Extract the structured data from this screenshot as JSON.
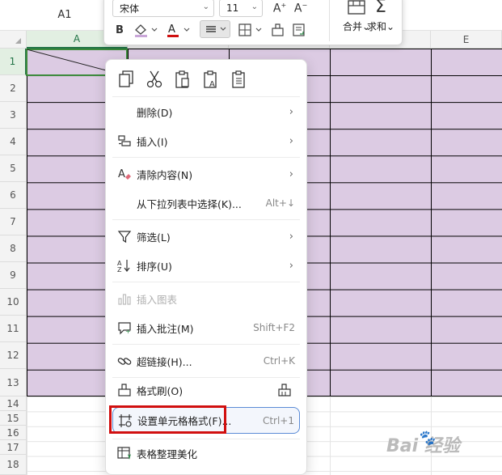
{
  "name_box": "A1",
  "columns": [
    {
      "label": "A",
      "active": true
    },
    {
      "label": "",
      "active": false
    },
    {
      "label": "",
      "active": false
    },
    {
      "label": "",
      "active": false
    },
    {
      "label": "E",
      "active": false
    }
  ],
  "rows": [
    "1",
    "2",
    "3",
    "4",
    "5",
    "6",
    "7",
    "8",
    "9",
    "10",
    "11",
    "12",
    "13",
    "14",
    "15",
    "16",
    "17",
    "18"
  ],
  "toolbar": {
    "font_name": "宋体",
    "font_size": "11",
    "merge_label": "合并",
    "sum_label": "求和"
  },
  "menu": {
    "clipboard_icons": [
      "copy-icon",
      "cut-icon",
      "paste-icon",
      "paste-values-icon",
      "paste-special-icon"
    ],
    "items": [
      {
        "label": "删除(D)",
        "shortcut": "",
        "submenu": true
      },
      {
        "label": "插入(I)",
        "shortcut": "",
        "submenu": true
      },
      {
        "label": "清除内容(N)",
        "shortcut": "",
        "submenu": true
      },
      {
        "label": "从下拉列表中选择(K)...",
        "shortcut": "Alt+↓",
        "submenu": false
      },
      {
        "label": "筛选(L)",
        "shortcut": "",
        "submenu": true
      },
      {
        "label": "排序(U)",
        "shortcut": "",
        "submenu": true
      },
      {
        "label": "插入图表",
        "shortcut": "",
        "submenu": false
      },
      {
        "label": "插入批注(M)",
        "shortcut": "Shift+F2",
        "submenu": false
      },
      {
        "label": "超链接(H)...",
        "shortcut": "Ctrl+K",
        "submenu": false
      },
      {
        "label": "格式刷(O)",
        "shortcut": "",
        "submenu": false
      },
      {
        "label": "设置单元格格式(F)...",
        "shortcut": "Ctrl+1",
        "submenu": false
      },
      {
        "label": "表格整理美化",
        "shortcut": "",
        "submenu": false
      }
    ]
  },
  "watermark": {
    "text": "Bai  经验"
  },
  "colors": {
    "purple_fill": "#dccbe3",
    "selection": "#3c8a3c",
    "highlight": "#d10f0f",
    "hover_border": "#5b8bd6"
  }
}
